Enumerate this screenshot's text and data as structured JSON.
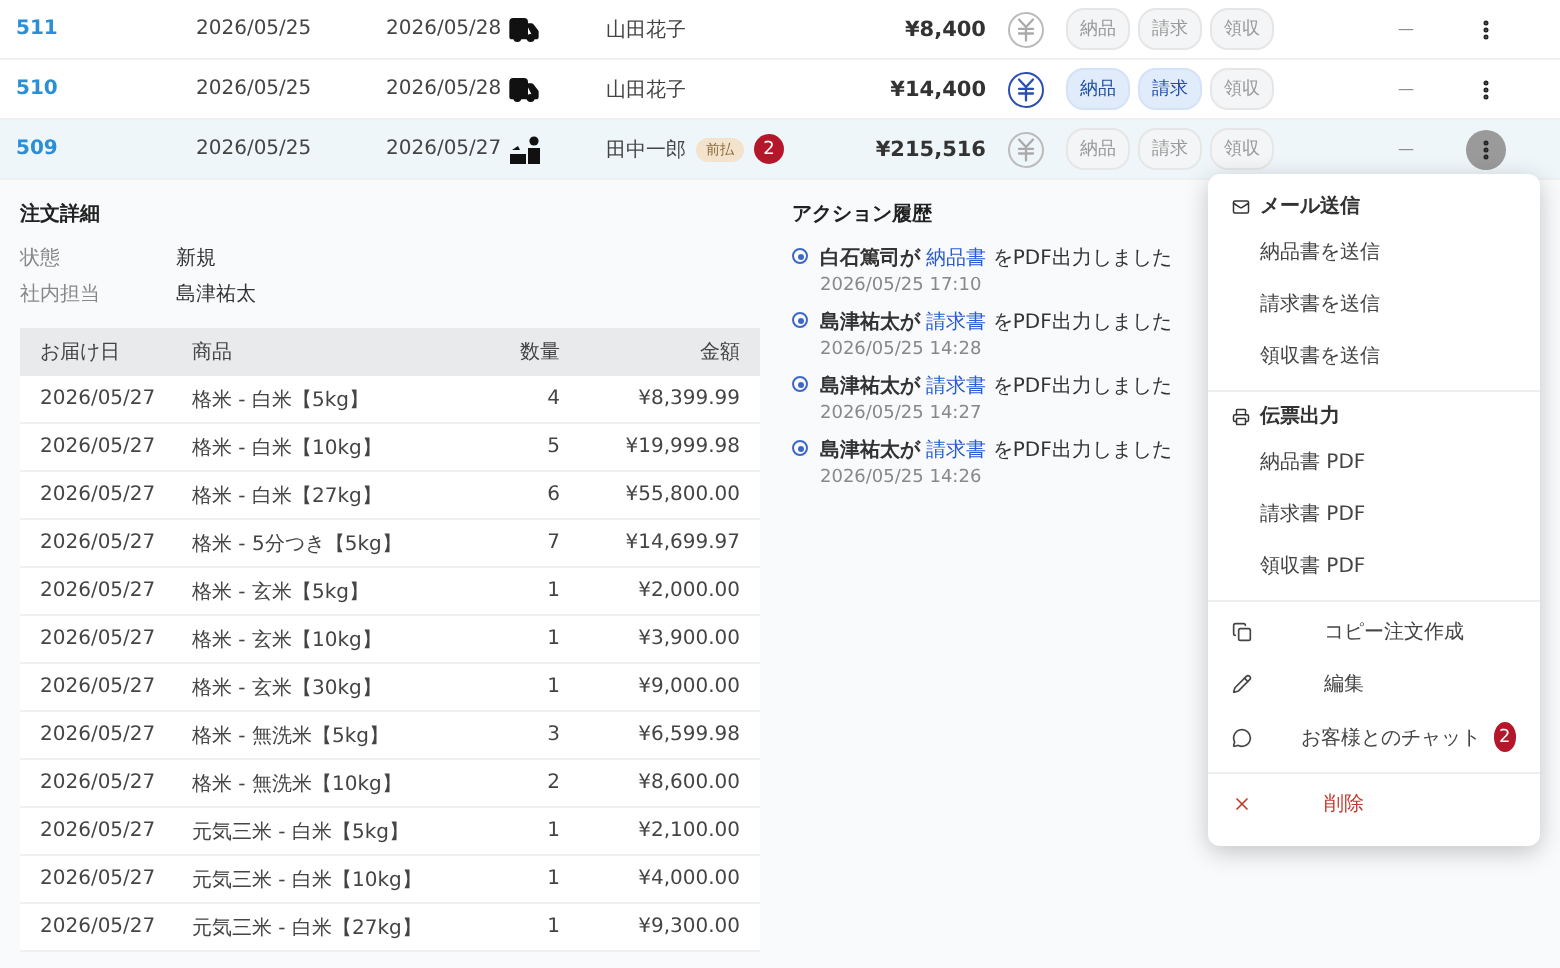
{
  "orders": [
    {
      "id": "511",
      "order_date": "2026/05/25",
      "delivery_date": "2026/05/28",
      "kind": "truck",
      "customer": "山田花子",
      "amount": "¥8,400",
      "paid": false,
      "docs": [
        {
          "label": "納品",
          "active": false
        },
        {
          "label": "請求",
          "active": false
        },
        {
          "label": "領収",
          "active": false
        }
      ],
      "note": "—",
      "selected": false
    },
    {
      "id": "510",
      "order_date": "2026/05/25",
      "delivery_date": "2026/05/28",
      "kind": "truck",
      "customer": "山田花子",
      "amount": "¥14,400",
      "paid": true,
      "docs": [
        {
          "label": "納品",
          "active": true
        },
        {
          "label": "請求",
          "active": true
        },
        {
          "label": "領収",
          "active": false
        }
      ],
      "note": "—",
      "selected": false
    },
    {
      "id": "509",
      "order_date": "2026/05/25",
      "delivery_date": "2026/05/27",
      "kind": "pickup",
      "customer": "田中一郎",
      "tag": "前払",
      "badge": "2",
      "amount": "¥215,516",
      "paid": false,
      "docs": [
        {
          "label": "納品",
          "active": false
        },
        {
          "label": "請求",
          "active": false
        },
        {
          "label": "領収",
          "active": false
        }
      ],
      "note": "—",
      "selected": true
    }
  ],
  "detail": {
    "title": "注文詳細",
    "fields": [
      {
        "label": "状態",
        "value": "新規"
      },
      {
        "label": "社内担当",
        "value": "島津祐太"
      }
    ],
    "columns": [
      "お届け日",
      "商品",
      "数量",
      "金額"
    ],
    "rows": [
      [
        "2026/05/27",
        "格米 - 白米【5kg】",
        "4",
        "¥8,399.99"
      ],
      [
        "2026/05/27",
        "格米 - 白米【10kg】",
        "5",
        "¥19,999.98"
      ],
      [
        "2026/05/27",
        "格米 - 白米【27kg】",
        "6",
        "¥55,800.00"
      ],
      [
        "2026/05/27",
        "格米 - 5分つき【5kg】",
        "7",
        "¥14,699.97"
      ],
      [
        "2026/05/27",
        "格米 - 玄米【5kg】",
        "1",
        "¥2,000.00"
      ],
      [
        "2026/05/27",
        "格米 - 玄米【10kg】",
        "1",
        "¥3,900.00"
      ],
      [
        "2026/05/27",
        "格米 - 玄米【30kg】",
        "1",
        "¥9,000.00"
      ],
      [
        "2026/05/27",
        "格米 - 無洗米【5kg】",
        "3",
        "¥6,599.98"
      ],
      [
        "2026/05/27",
        "格米 - 無洗米【10kg】",
        "2",
        "¥8,600.00"
      ],
      [
        "2026/05/27",
        "元気三米 - 白米【5kg】",
        "1",
        "¥2,100.00"
      ],
      [
        "2026/05/27",
        "元気三米 - 白米【10kg】",
        "1",
        "¥4,000.00"
      ],
      [
        "2026/05/27",
        "元気三米 - 白米【27kg】",
        "1",
        "¥9,300.00"
      ]
    ]
  },
  "history": {
    "title": "アクション履歴",
    "entries": [
      {
        "actor": "白石篤司が",
        "doc": "納品書",
        "action": "をPDF出力しました",
        "time": "2026/05/25 17:10"
      },
      {
        "actor": "島津祐太が",
        "doc": "請求書",
        "action": "をPDF出力しました",
        "time": "2026/05/25 14:28"
      },
      {
        "actor": "島津祐太が",
        "doc": "請求書",
        "action": "をPDF出力しました",
        "time": "2026/05/25 14:27"
      },
      {
        "actor": "島津祐太が",
        "doc": "請求書",
        "action": "をPDF出力しました",
        "time": "2026/05/25 14:26"
      }
    ]
  },
  "menu": {
    "sections": [
      {
        "kind": "group",
        "title": "メール送信",
        "items": [
          "納品書を送信",
          "請求書を送信",
          "領収書を送信"
        ]
      },
      {
        "kind": "group",
        "title": "伝票出力",
        "items": [
          "納品書 PDF",
          "請求書 PDF",
          "領収書 PDF"
        ]
      },
      {
        "kind": "actions",
        "items": [
          {
            "label": "コピー注文作成"
          },
          {
            "label": "編集"
          },
          {
            "label": "お客様とのチャット",
            "badge": "2"
          }
        ]
      },
      {
        "kind": "danger",
        "items": [
          {
            "label": "削除"
          }
        ]
      }
    ]
  }
}
